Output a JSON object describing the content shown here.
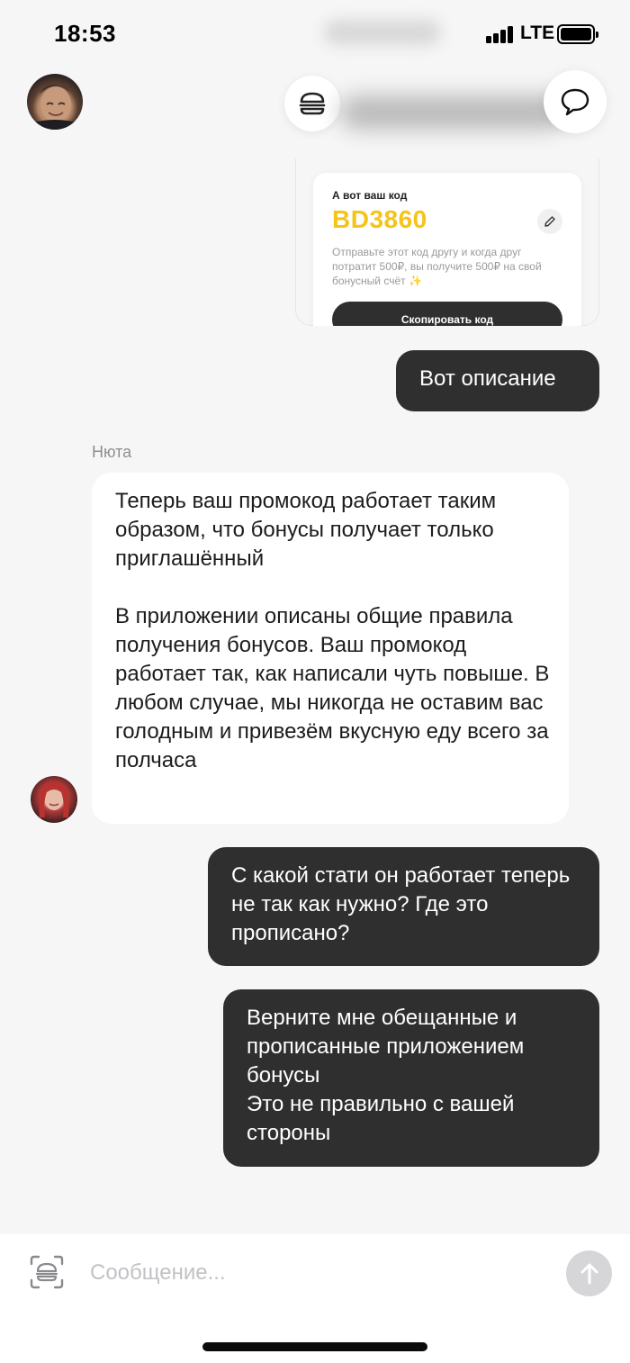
{
  "status_bar": {
    "time": "18:53",
    "network": "LTE"
  },
  "header": {
    "user_avatar_icon": "user-avatar-photo",
    "menu_icon": "burger-icon",
    "support_icon": "chat-bubble-icon"
  },
  "promo_card": {
    "caption": "А вот ваш код",
    "code": "BD3860",
    "description": "Отправьте этот код другу и когда друг потратит 500₽, вы получите 500₽ на свой бонусный счёт ✨",
    "copy_button": "Скопировать код",
    "edit_icon": "pencil-icon",
    "accent_color": "#F6C417"
  },
  "messages": [
    {
      "direction": "outgoing",
      "text": "Вот описание"
    },
    {
      "direction": "incoming",
      "sender": "Нюта",
      "text": "Теперь ваш промокод работает таким образом, что бонусы получает только приглашённый\n\nВ приложении описаны общие правила получения бонусов. Ваш промокод работает так, как написали чуть повыше. В любом случае, мы никогда не оставим вас голодным и привезём вкусную еду всего за полчаса"
    },
    {
      "direction": "outgoing",
      "text": "С какой стати он работает теперь не так как нужно? Где это прописано?"
    },
    {
      "direction": "outgoing",
      "text": "Верните мне обещанные и прописанные приложением бонусы\nЭто не правильно с вашей стороны"
    }
  ],
  "composer": {
    "placeholder": "Сообщение...",
    "value": "",
    "scan_icon": "burger-scan-icon",
    "send_icon": "arrow-up-icon"
  },
  "colors": {
    "background": "#F6F6F6",
    "outgoing_bubble": "#2F2F2F",
    "incoming_bubble": "#FFFFFF"
  }
}
